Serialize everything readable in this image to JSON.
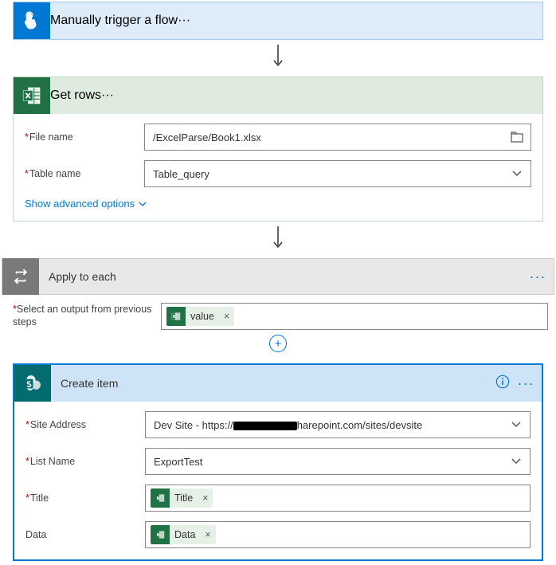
{
  "trigger": {
    "title": "Manually trigger a flow"
  },
  "getRows": {
    "title": "Get rows",
    "fields": {
      "fileName": {
        "label": "File name",
        "value": "/ExcelParse/Book1.xlsx"
      },
      "tableName": {
        "label": "Table name",
        "value": "Table_query"
      }
    },
    "advancedLink": "Show advanced options"
  },
  "applyToEach": {
    "title": "Apply to each",
    "selectOutputLabel": "Select an output from previous steps",
    "token": "value"
  },
  "createItem": {
    "title": "Create item",
    "fields": {
      "siteAddress": {
        "label": "Site Address",
        "prefix": "Dev Site - https://",
        "suffix": "harepoint.com/sites/devsite"
      },
      "listName": {
        "label": "List Name",
        "value": "ExportTest"
      },
      "title": {
        "label": "Title",
        "token": "Title"
      },
      "data": {
        "label": "Data",
        "token": "Data"
      }
    }
  },
  "glyphs": {
    "more": "···",
    "close": "×",
    "plus": "+",
    "req": "*"
  }
}
